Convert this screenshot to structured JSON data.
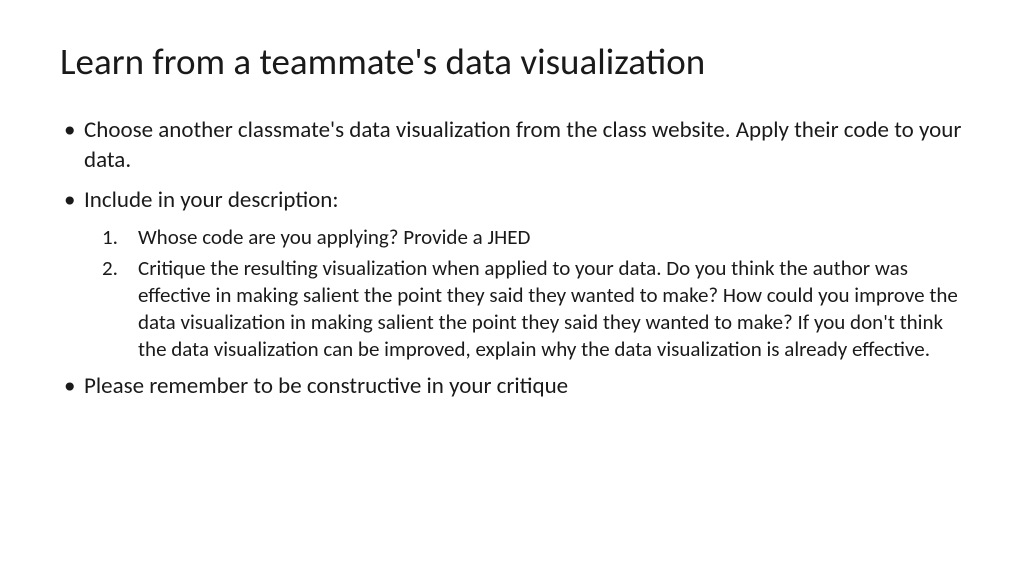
{
  "slide": {
    "title": "Learn from a teammate's data visualization",
    "bullets": [
      {
        "text": "Choose another classmate's data visualization from the class website. Apply their code to your data."
      },
      {
        "text": "Include in your description:",
        "numbered": [
          "Whose code are you applying? Provide a JHED",
          "Critique the resulting visualization when applied to your data. Do you think the author was effective in making salient the point they said they wanted to make? How could you improve the data visualization in making salient the point they said they wanted to make? If you don't think the data visualization can be improved, explain why the data visualization is already effective."
        ]
      },
      {
        "text": "Please remember to be constructive in your critique"
      }
    ]
  }
}
